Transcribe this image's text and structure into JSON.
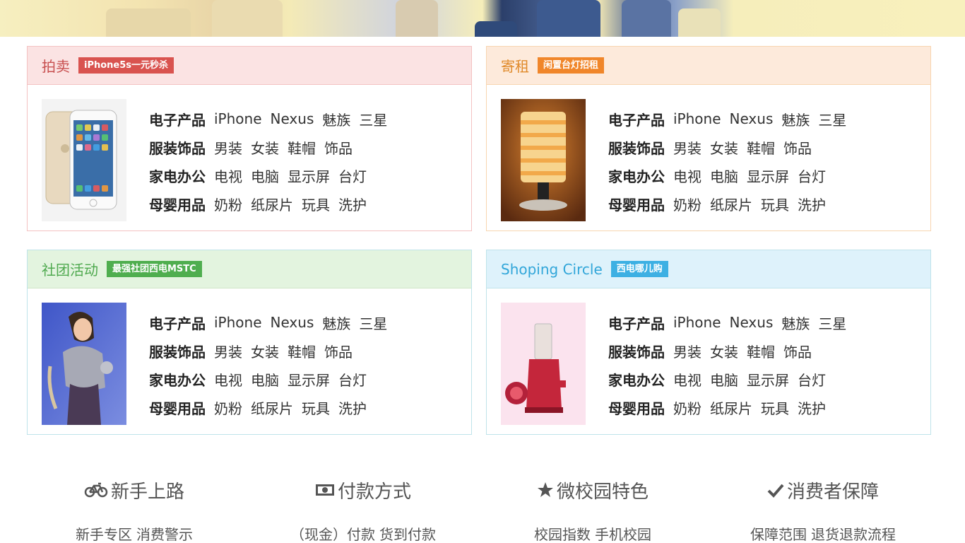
{
  "panels": [
    {
      "id": "auction",
      "title": "拍卖",
      "tag": "iPhone5s一元秒杀",
      "image": "iphone-image",
      "categories": [
        {
          "name": "电子产品",
          "items": [
            "iPhone",
            "Nexus",
            "魅族",
            "三星"
          ]
        },
        {
          "name": "服装饰品",
          "items": [
            "男装",
            "女装",
            "鞋帽",
            "饰品"
          ]
        },
        {
          "name": "家电办公",
          "items": [
            "电视",
            "电脑",
            "显示屏",
            "台灯"
          ]
        },
        {
          "name": "母婴用品",
          "items": [
            "奶粉",
            "纸尿片",
            "玩具",
            "洗护"
          ]
        }
      ]
    },
    {
      "id": "rent",
      "title": "寄租",
      "tag": "闲置台灯招租",
      "image": "lamp-image",
      "categories": [
        {
          "name": "电子产品",
          "items": [
            "iPhone",
            "Nexus",
            "魅族",
            "三星"
          ]
        },
        {
          "name": "服装饰品",
          "items": [
            "男装",
            "女装",
            "鞋帽",
            "饰品"
          ]
        },
        {
          "name": "家电办公",
          "items": [
            "电视",
            "电脑",
            "显示屏",
            "台灯"
          ]
        },
        {
          "name": "母婴用品",
          "items": [
            "奶粉",
            "纸尿片",
            "玩具",
            "洗护"
          ]
        }
      ]
    },
    {
      "id": "club",
      "title": "社团活动",
      "tag": "最强社团西电MSTC",
      "image": "character-image",
      "categories": [
        {
          "name": "电子产品",
          "items": [
            "iPhone",
            "Nexus",
            "魅族",
            "三星"
          ]
        },
        {
          "name": "服装饰品",
          "items": [
            "男装",
            "女装",
            "鞋帽",
            "饰品"
          ]
        },
        {
          "name": "家电办公",
          "items": [
            "电视",
            "电脑",
            "显示屏",
            "台灯"
          ]
        },
        {
          "name": "母婴用品",
          "items": [
            "奶粉",
            "纸尿片",
            "玩具",
            "洗护"
          ]
        }
      ]
    },
    {
      "id": "shop",
      "title": "Shoping Circle",
      "tag": "西电哪儿购",
      "image": "juicer-image",
      "categories": [
        {
          "name": "电子产品",
          "items": [
            "iPhone",
            "Nexus",
            "魅族",
            "三星"
          ]
        },
        {
          "name": "服装饰品",
          "items": [
            "男装",
            "女装",
            "鞋帽",
            "饰品"
          ]
        },
        {
          "name": "家电办公",
          "items": [
            "电视",
            "电脑",
            "显示屏",
            "台灯"
          ]
        },
        {
          "name": "母婴用品",
          "items": [
            "奶粉",
            "纸尿片",
            "玩具",
            "洗护"
          ]
        }
      ]
    }
  ],
  "footer": [
    {
      "icon": "bicycle-icon",
      "title": "新手上路",
      "links": [
        "新手专区",
        "消费警示"
      ]
    },
    {
      "icon": "money-icon",
      "title": "付款方式",
      "links": [
        "（现金）付款",
        "货到付款"
      ]
    },
    {
      "icon": "star-icon",
      "title": "微校园特色",
      "links": [
        "校园指数",
        "手机校园"
      ]
    },
    {
      "icon": "check-icon",
      "title": "消费者保障",
      "links": [
        "保障范围",
        "退货退款流程"
      ]
    }
  ]
}
